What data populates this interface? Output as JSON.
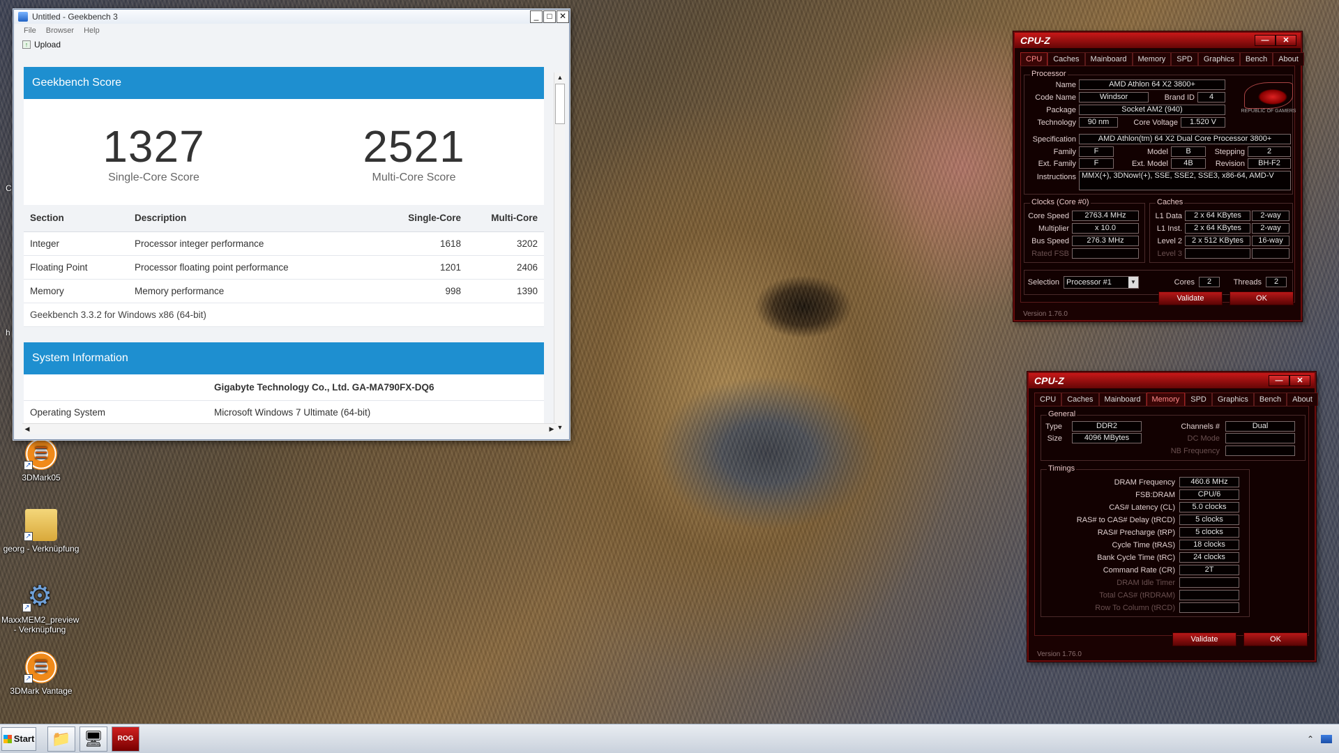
{
  "desktop": {
    "icons": [
      {
        "label": "3DMark05",
        "icon": "3dmark-icon"
      },
      {
        "label": "georg - Verknüpfung",
        "icon": "user-folder-icon"
      },
      {
        "label": "MaxxMEM2_preview - Verknüpfung",
        "icon": "gear-icon"
      },
      {
        "label": "3DMark Vantage",
        "icon": "3dmark-icon"
      }
    ],
    "edge_c": "C",
    "edge_h": "h"
  },
  "geekbench": {
    "title": "Untitled - Geekbench 3",
    "menu": [
      "File",
      "Browser",
      "Help"
    ],
    "toolbar_upload": "Upload",
    "score_header": "Geekbench Score",
    "single_score": "1327",
    "single_label": "Single-Core Score",
    "multi_score": "2521",
    "multi_label": "Multi-Core Score",
    "columns": [
      "Section",
      "Description",
      "Single-Core",
      "Multi-Core"
    ],
    "rows": [
      {
        "section": "Integer",
        "description": "Processor integer performance",
        "single": "1618",
        "multi": "3202"
      },
      {
        "section": "Floating Point",
        "description": "Processor floating point performance",
        "single": "1201",
        "multi": "2406"
      },
      {
        "section": "Memory",
        "description": "Memory performance",
        "single": "998",
        "multi": "1390"
      }
    ],
    "version_line": "Geekbench 3.3.2 for Windows x86 (64-bit)",
    "sys_header": "System Information",
    "sys_model": "Gigabyte Technology Co., Ltd. GA-MA790FX-DQ6",
    "sys_rows": [
      {
        "label": "Operating System",
        "value": "Microsoft Windows 7 Ultimate (64-bit)"
      }
    ]
  },
  "cpuz_cpu": {
    "title": "CPU-Z",
    "tabs": [
      "CPU",
      "Caches",
      "Mainboard",
      "Memory",
      "SPD",
      "Graphics",
      "Bench",
      "About"
    ],
    "active_tab": "CPU",
    "processor_group": "Processor",
    "name_label": "Name",
    "name": "AMD Athlon 64 X2 3800+",
    "codename_label": "Code Name",
    "codename": "Windsor",
    "brandid_label": "Brand ID",
    "brandid": "4",
    "package_label": "Package",
    "package": "Socket AM2 (940)",
    "tech_label": "Technology",
    "tech": "90 nm",
    "voltage_label": "Core Voltage",
    "voltage": "1.520 V",
    "spec_label": "Specification",
    "spec": "AMD Athlon(tm) 64 X2 Dual Core Processor 3800+",
    "family_label": "Family",
    "family": "F",
    "model_label": "Model",
    "model": "B",
    "stepping_label": "Stepping",
    "stepping": "2",
    "extfamily_label": "Ext. Family",
    "extfamily": "F",
    "extmodel_label": "Ext. Model",
    "extmodel": "4B",
    "revision_label": "Revision",
    "revision": "BH-F2",
    "instr_label": "Instructions",
    "instr": "MMX(+), 3DNow!(+), SSE, SSE2, SSE3, x86-64, AMD-V",
    "clocks_group": "Clocks (Core #0)",
    "corespeed_label": "Core Speed",
    "corespeed": "2763.4 MHz",
    "multiplier_label": "Multiplier",
    "multiplier": "x 10.0",
    "busspeed_label": "Bus Speed",
    "busspeed": "276.3 MHz",
    "ratedfsb_label": "Rated FSB",
    "caches_group": "Caches",
    "l1d_label": "L1 Data",
    "l1d": "2 x 64 KBytes",
    "l1d_way": "2-way",
    "l1i_label": "L1 Inst.",
    "l1i": "2 x 64 KBytes",
    "l1i_way": "2-way",
    "l2_label": "Level 2",
    "l2": "2 x 512 KBytes",
    "l2_way": "16-way",
    "l3_label": "Level 3",
    "selection_label": "Selection",
    "selection": "Processor #1",
    "cores_label": "Cores",
    "cores": "2",
    "threads_label": "Threads",
    "threads": "2",
    "validate": "Validate",
    "ok": "OK",
    "version": "Version 1.76.0",
    "logo_text": "REPUBLIC OF GAMERS"
  },
  "cpuz_mem": {
    "title": "CPU-Z",
    "tabs": [
      "CPU",
      "Caches",
      "Mainboard",
      "Memory",
      "SPD",
      "Graphics",
      "Bench",
      "About"
    ],
    "active_tab": "Memory",
    "general_group": "General",
    "type_label": "Type",
    "type": "DDR2",
    "size_label": "Size",
    "size": "4096 MBytes",
    "channels_label": "Channels #",
    "channels": "Dual",
    "dcmode_label": "DC Mode",
    "nbfreq_label": "NB Frequency",
    "timings_group": "Timings",
    "timings": [
      {
        "label": "DRAM Frequency",
        "value": "460.6 MHz",
        "dim": false
      },
      {
        "label": "FSB:DRAM",
        "value": "CPU/6",
        "dim": false
      },
      {
        "label": "CAS# Latency (CL)",
        "value": "5.0 clocks",
        "dim": false
      },
      {
        "label": "RAS# to CAS# Delay (tRCD)",
        "value": "5 clocks",
        "dim": false
      },
      {
        "label": "RAS# Precharge (tRP)",
        "value": "5 clocks",
        "dim": false
      },
      {
        "label": "Cycle Time (tRAS)",
        "value": "18 clocks",
        "dim": false
      },
      {
        "label": "Bank Cycle Time (tRC)",
        "value": "24 clocks",
        "dim": false
      },
      {
        "label": "Command Rate (CR)",
        "value": "2T",
        "dim": false
      },
      {
        "label": "DRAM Idle Timer",
        "value": "",
        "dim": true
      },
      {
        "label": "Total CAS# (tRDRAM)",
        "value": "",
        "dim": true
      },
      {
        "label": "Row To Column (tRCD)",
        "value": "",
        "dim": true
      }
    ],
    "validate": "Validate",
    "ok": "OK",
    "version": "Version 1.76.0"
  },
  "taskbar": {
    "start": "Start"
  }
}
